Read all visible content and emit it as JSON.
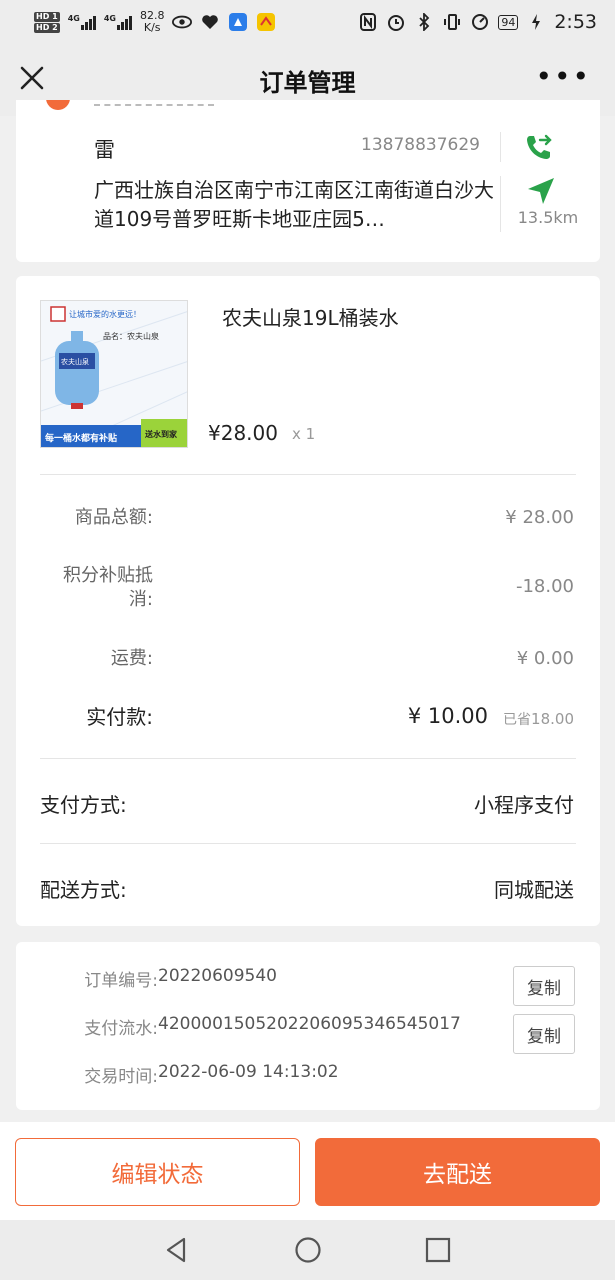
{
  "status_bar": {
    "hd1": "HD 1",
    "hd2": "HD 2",
    "net1": "4G",
    "net2": "4G",
    "speed_value": "82.8",
    "speed_unit": "K/s",
    "battery": "94",
    "time": "2:53"
  },
  "nav": {
    "title": "订单管理",
    "more": "•••"
  },
  "address": {
    "name": "雷",
    "phone": "13878837629",
    "address_text": "广西壮族自治区南宁市江南区江南街道白沙大道109号普罗旺斯卡地亚庄园5…",
    "distance": "13.5km"
  },
  "product": {
    "name": "农夫山泉19L桶装水",
    "price": "¥28.00",
    "qty": "x 1",
    "image_banner": "每一桶水都有补贴",
    "image_tag": "送水到家",
    "image_slogan": "让城市爱的水更远！",
    "image_caption": "品名：农夫山泉",
    "image_brand": "农夫山泉"
  },
  "summary": {
    "goods_total_label": "商品总额:",
    "goods_total_value": "¥  28.00",
    "points_label_line1": "积分补贴抵",
    "points_label_line2": "消:",
    "points_value": "-18.00",
    "shipping_label": "运费:",
    "shipping_value": "¥  0.00",
    "paid_label": "实付款:",
    "paid_value": "¥  10.00",
    "saved_prefix": "已省",
    "saved_value": "18.00"
  },
  "payment": {
    "label": "支付方式:",
    "value": "小程序支付"
  },
  "delivery": {
    "label": "配送方式:",
    "value": "同城配送"
  },
  "order_info": {
    "order_no_label": "订单编号:",
    "order_no_value": "20220609540",
    "serial_label": "支付流水:",
    "serial_value": "4200001505202206095346545017",
    "time_label": "交易时间:",
    "time_value": "2022-06-09 14:13:02",
    "copy_label": "复制"
  },
  "actions": {
    "edit_status": "编辑状态",
    "deliver": "去配送"
  },
  "colors": {
    "accent": "#f26b3a",
    "green": "#2aa24a"
  }
}
